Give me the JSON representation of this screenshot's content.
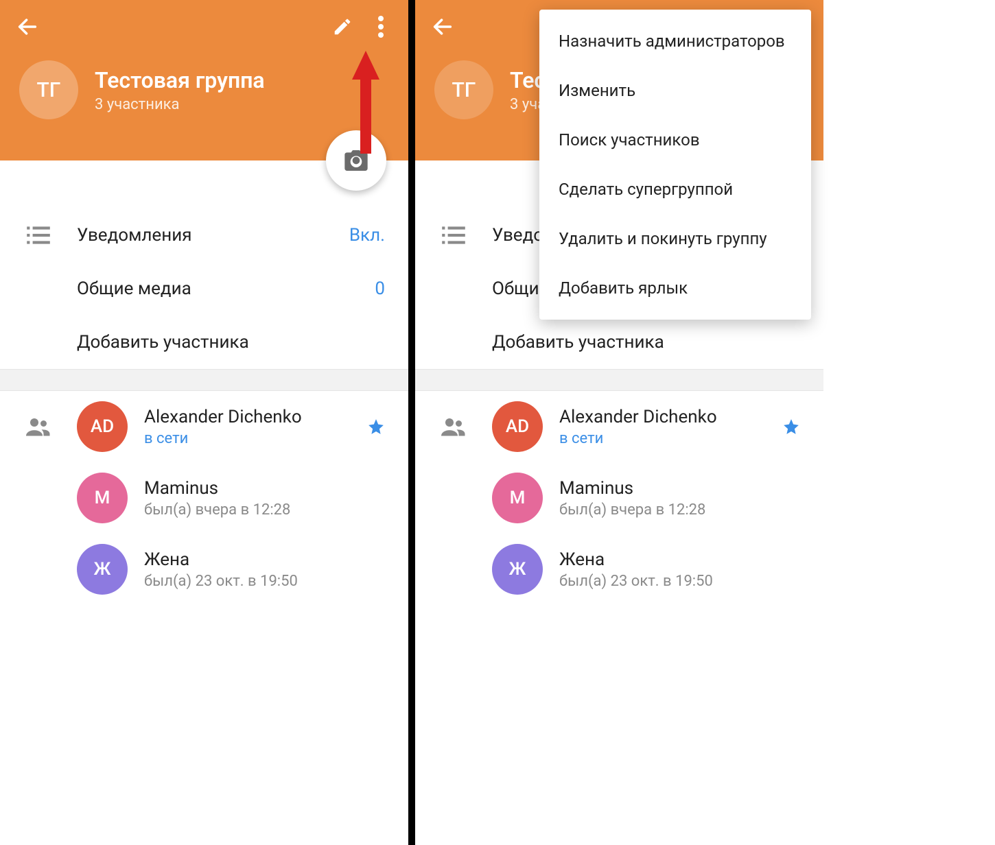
{
  "group": {
    "avatar_initials": "ТГ",
    "title": "Тестовая группа",
    "subtitle": "3 участника"
  },
  "settings": {
    "notifications": {
      "label": "Уведомления",
      "value": "Вкл."
    },
    "shared_media": {
      "label": "Общие медиа",
      "value": "0"
    },
    "add_member": {
      "label": "Добавить участника"
    }
  },
  "members": [
    {
      "initials": "AD",
      "name": "Alexander Dichenko",
      "status": "в сети",
      "online": true,
      "starred": true,
      "color": "#e2583e"
    },
    {
      "initials": "M",
      "name": "Maminus",
      "status": "был(а) вчера в 12:28",
      "online": false,
      "starred": false,
      "color": "#e5699a"
    },
    {
      "initials": "Ж",
      "name": "Жена",
      "status": "был(а) 23 окт. в 19:50",
      "online": false,
      "starred": false,
      "color": "#8d7ae0"
    }
  ],
  "menu": {
    "items": [
      "Назначить администраторов",
      "Изменить",
      "Поиск участников",
      "Сделать супергруппой",
      "Удалить и покинуть группу",
      "Добавить ярлык"
    ]
  },
  "colors": {
    "header": "#ec8a3d",
    "accent": "#3a8ee6",
    "arrow": "#d92020"
  }
}
